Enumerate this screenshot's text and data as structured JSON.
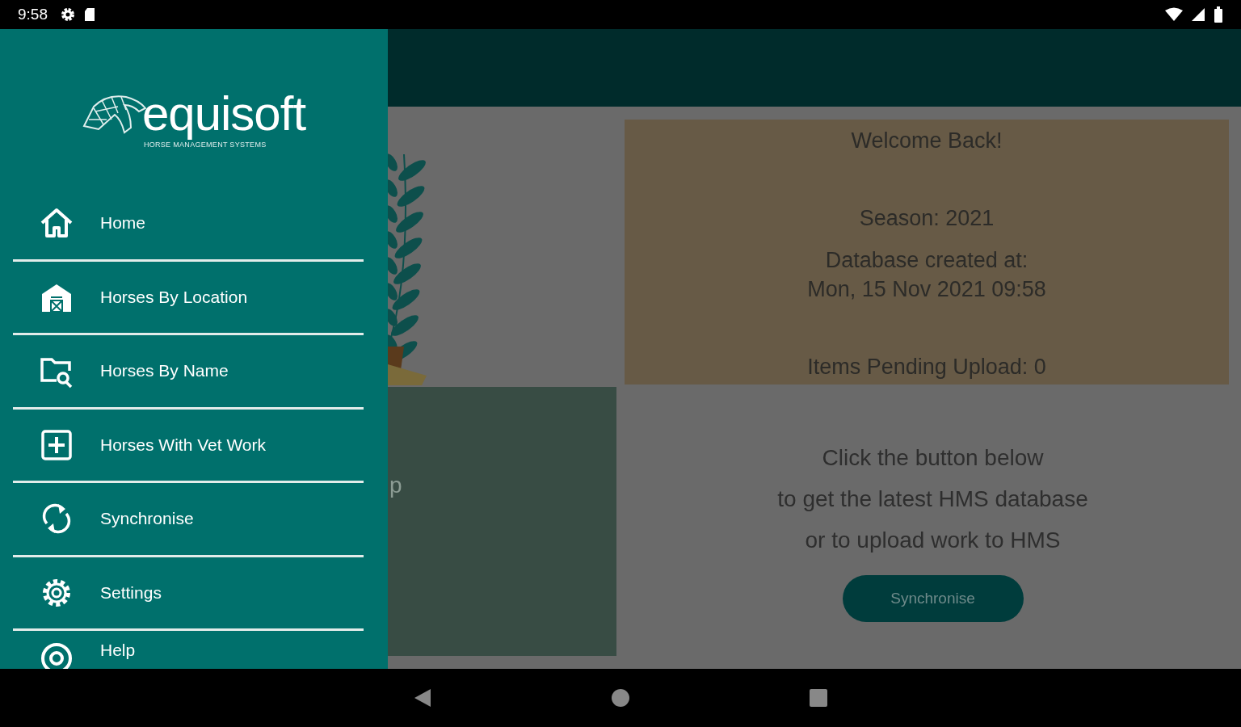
{
  "status_bar": {
    "time": "9:58"
  },
  "drawer": {
    "logo": {
      "name": "equisoft",
      "tagline": "HORSE MANAGEMENT SYSTEMS"
    },
    "items": [
      {
        "label": "Home",
        "kind": "home"
      },
      {
        "label": "Horses By Location",
        "kind": "barn"
      },
      {
        "label": "Horses By Name",
        "kind": "folder-search"
      },
      {
        "label": "Horses With Vet Work",
        "kind": "plus-box"
      },
      {
        "label": "Synchronise",
        "kind": "sync"
      },
      {
        "label": "Settings",
        "kind": "gear"
      },
      {
        "label": "Help",
        "kind": "help"
      }
    ]
  },
  "main": {
    "tile_label": "p",
    "welcome_card": {
      "title": "Welcome Back!",
      "season": "Season: 2021",
      "created_label": "Database created at:",
      "created_value": "Mon, 15 Nov 2021 09:58",
      "pending": "Items Pending Upload: 0"
    },
    "sync_panel": {
      "lines": [
        "Click the button below",
        "to get the latest HMS database",
        "or to upload work to HMS"
      ],
      "button": "Synchronise"
    }
  }
}
